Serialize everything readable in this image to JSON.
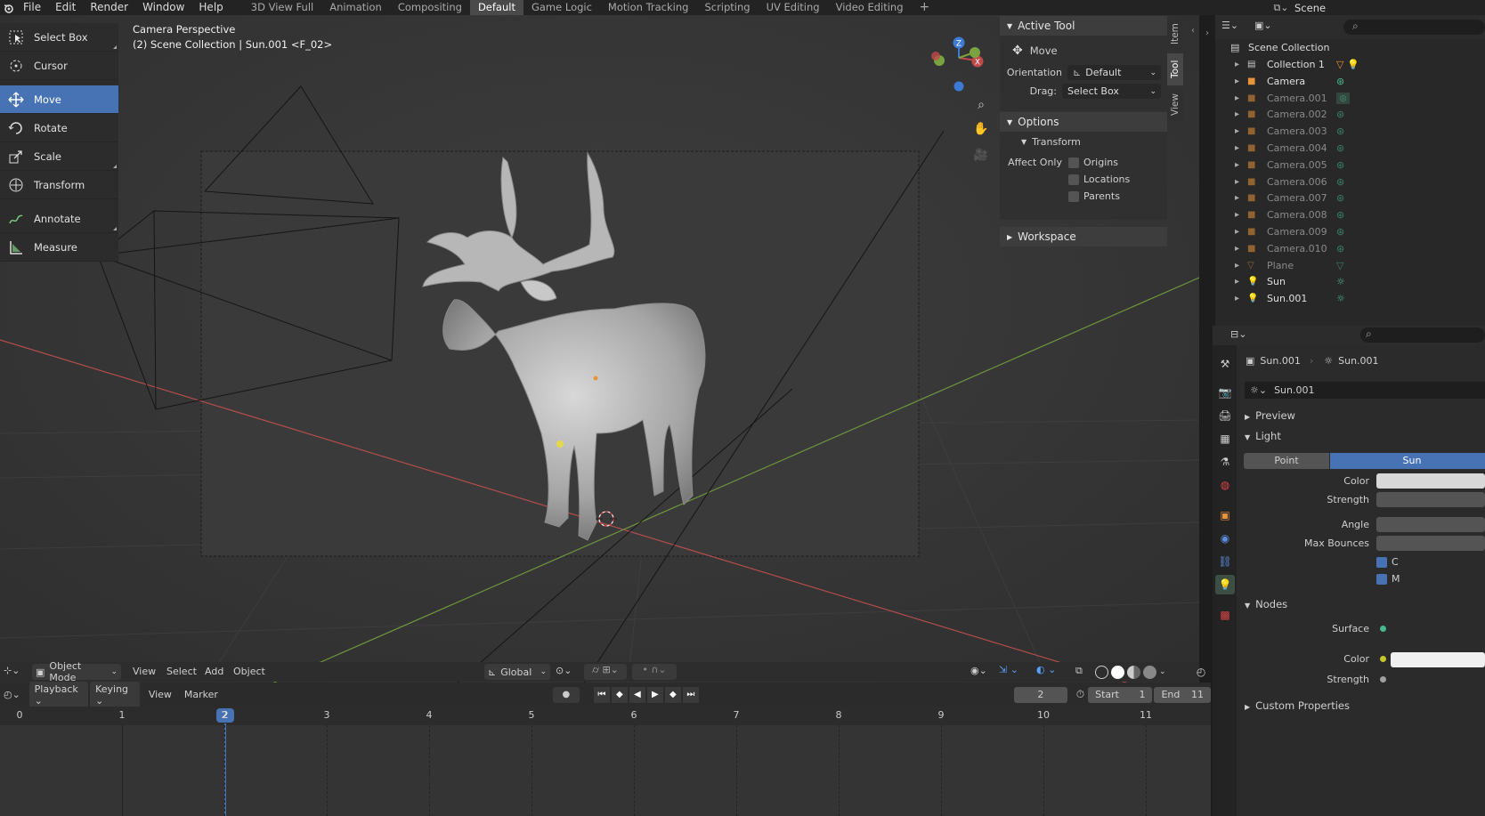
{
  "menu": [
    "File",
    "Edit",
    "Render",
    "Window",
    "Help"
  ],
  "workspaces": [
    "3D View Full",
    "Animation",
    "Compositing",
    "Default",
    "Game Logic",
    "Motion Tracking",
    "Scripting",
    "UV Editing",
    "Video Editing"
  ],
  "active_workspace": "Default",
  "scene_name": "Scene",
  "viewport": {
    "title": "Camera Perspective",
    "subtitle": "(2) Scene Collection | Sun.001 <F_02>"
  },
  "tools": [
    {
      "label": "Select Box",
      "icon": "select-box-icon"
    },
    {
      "label": "Cursor",
      "icon": "cursor-icon"
    },
    {
      "label": "Move",
      "icon": "move-icon"
    },
    {
      "label": "Rotate",
      "icon": "rotate-icon"
    },
    {
      "label": "Scale",
      "icon": "scale-icon"
    },
    {
      "label": "Transform",
      "icon": "transform-icon"
    },
    {
      "label": "Annotate",
      "icon": "annotate-icon"
    },
    {
      "label": "Measure",
      "icon": "measure-icon"
    }
  ],
  "active_tool": "Move",
  "npanel": {
    "active_tool_header": "Active Tool",
    "tool_name": "Move",
    "orientation_label": "Orientation",
    "orientation_value": "Default",
    "drag_label": "Drag:",
    "drag_value": "Select Box",
    "options_header": "Options",
    "transform_header": "Transform",
    "affect_only_label": "Affect Only",
    "checkboxes": [
      "Origins",
      "Locations",
      "Parents"
    ],
    "workspace_header": "Workspace",
    "side_tabs": [
      "Item",
      "Tool",
      "View"
    ]
  },
  "viewport_header": {
    "mode": "Object Mode",
    "menus": [
      "View",
      "Select",
      "Add",
      "Object"
    ],
    "orientation": "Global"
  },
  "timeline": {
    "menus": [
      "Playback",
      "Keying",
      "View",
      "Marker"
    ],
    "current_frame": "2",
    "start_label": "Start",
    "start_value": "1",
    "end_label": "End",
    "end_value": "11",
    "ruler": [
      "0",
      "1",
      "2",
      "3",
      "4",
      "5",
      "6",
      "7",
      "8",
      "9",
      "10",
      "11"
    ]
  },
  "outliner": {
    "root": "Scene Collection",
    "items": [
      {
        "name": "Collection 1",
        "type": "collection"
      },
      {
        "name": "Camera",
        "type": "camera"
      },
      {
        "name": "Camera.001",
        "type": "camera"
      },
      {
        "name": "Camera.002",
        "type": "camera"
      },
      {
        "name": "Camera.003",
        "type": "camera"
      },
      {
        "name": "Camera.004",
        "type": "camera"
      },
      {
        "name": "Camera.005",
        "type": "camera"
      },
      {
        "name": "Camera.006",
        "type": "camera"
      },
      {
        "name": "Camera.007",
        "type": "camera"
      },
      {
        "name": "Camera.008",
        "type": "camera"
      },
      {
        "name": "Camera.009",
        "type": "camera"
      },
      {
        "name": "Camera.010",
        "type": "camera"
      },
      {
        "name": "Plane",
        "type": "mesh"
      },
      {
        "name": "Sun",
        "type": "light"
      },
      {
        "name": "Sun.001",
        "type": "light"
      }
    ]
  },
  "properties": {
    "object_name": "Sun.001",
    "data_name": "Sun.001",
    "datablock": "Sun.001",
    "preview_header": "Preview",
    "light_header": "Light",
    "light_types": [
      "Point",
      "Sun"
    ],
    "active_light_type": "Sun",
    "color_label": "Color",
    "strength_label": "Strength",
    "angle_label": "Angle",
    "max_bounces_label": "Max Bounces",
    "check1": "C",
    "check2": "M",
    "nodes_header": "Nodes",
    "surface_label": "Surface",
    "node_color_label": "Color",
    "node_strength_label": "Strength",
    "custom_props_header": "Custom Properties"
  },
  "colors": {
    "accent": "#4772b3",
    "x_axis": "#c04a4a",
    "y_axis": "#7aa340",
    "z_axis": "#3d7ad6",
    "camera_icon": "#e8943a",
    "data_icon": "#47b88e"
  }
}
